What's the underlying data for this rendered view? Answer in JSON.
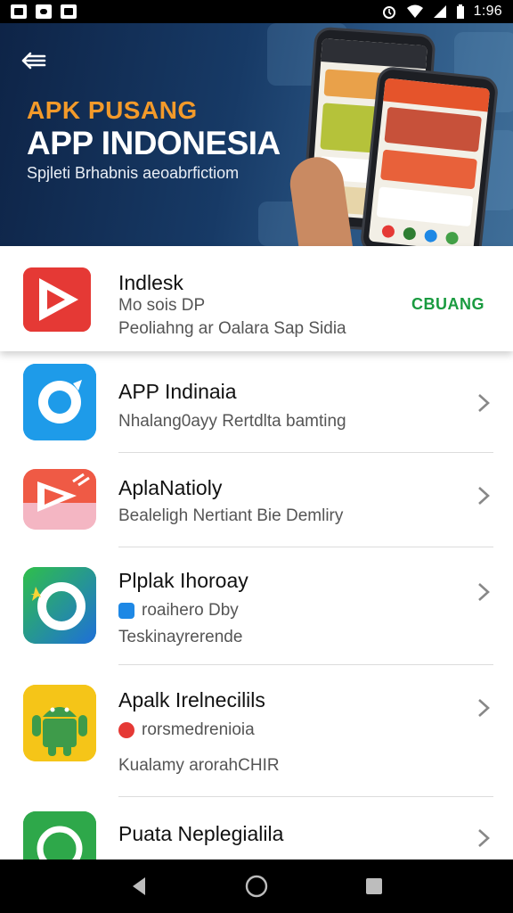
{
  "status_bar": {
    "time": "1:96",
    "left_icons": [
      "gallery-icon",
      "message-icon",
      "photo-icon"
    ],
    "right_icons": [
      "alarm-icon",
      "wifi-icon",
      "signal-icon",
      "battery-icon"
    ]
  },
  "banner": {
    "kicker": "APK PUSANG",
    "title": "APP INDONESIA",
    "subtitle": "Spjleti Brhabnis aeoabrfictiom",
    "back_icon": "back-arrow-icon",
    "colors": {
      "kicker": "#f39a2a",
      "background": "#173a66"
    }
  },
  "featured": {
    "name": "Indlesk",
    "meta": "Mo sois DP",
    "description": "Peoliahng ar Oalara Sap Sidia",
    "action_label": "CBUANG",
    "icon": "red-play-icon",
    "colors": {
      "action": "#1a9b40",
      "icon": "#e53935"
    }
  },
  "apps": [
    {
      "name": "APP Indinaia",
      "line1": "Nhalang0ayy Rertdlta bamting",
      "line2": "",
      "icon": "blue-chat-icon"
    },
    {
      "name": "AplaNatioly",
      "line1": "Bealeligh Nertiant Bie Demliry",
      "line2": "",
      "icon": "red-play-pink-icon"
    },
    {
      "name": "Plplak Ihoroay",
      "line1": "roaihero Dby",
      "line2": "Teskinayrerende",
      "icon": "green-refresh-icon"
    },
    {
      "name": "Apalk Irelnecilils",
      "line1": "rorsmedrenioia",
      "line2": "Kualamy arorahCHIR",
      "icon": "android-robot-icon"
    },
    {
      "name": "Puata Neplegialila",
      "line1": "",
      "line2": "",
      "icon": "green-whatsapp-icon"
    }
  ],
  "nav_bar": {
    "back": "nav-back-icon",
    "home": "nav-home-icon",
    "recents": "nav-recents-icon"
  }
}
